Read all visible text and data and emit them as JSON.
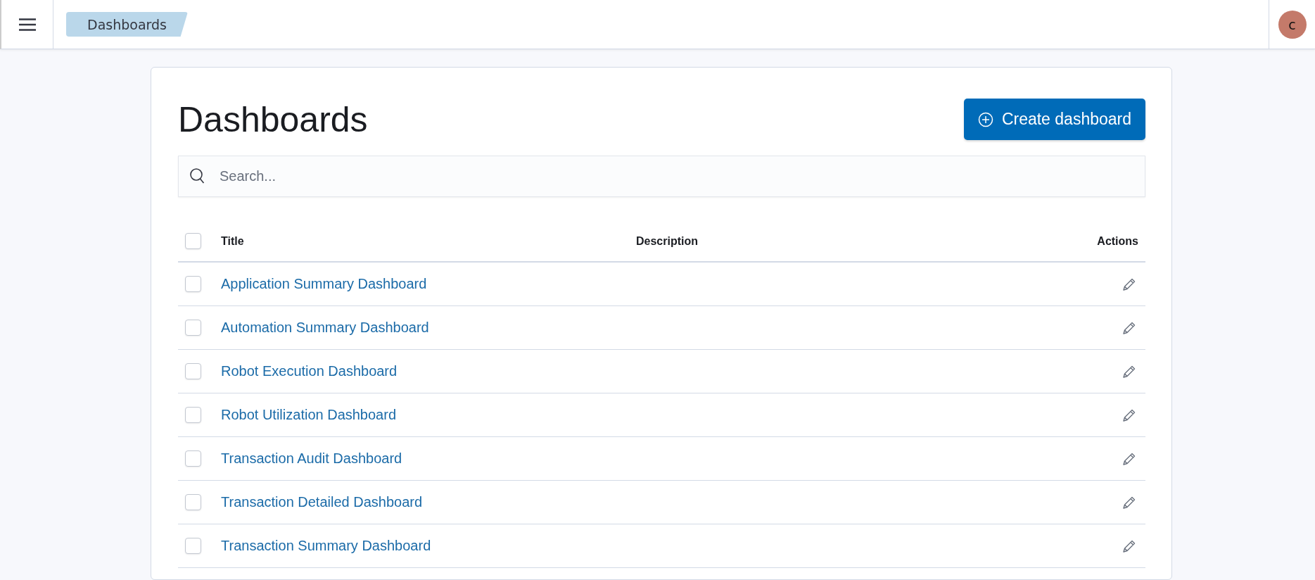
{
  "header": {
    "breadcrumb": "Dashboards",
    "avatar": "c"
  },
  "page": {
    "title": "Dashboards",
    "create_button": "Create dashboard"
  },
  "search": {
    "placeholder": "Search..."
  },
  "table": {
    "select_all_checked": false,
    "columns": [
      "Title",
      "Description",
      "Actions"
    ],
    "rows": [
      {
        "title": "Application Summary Dashboard",
        "checked": false
      },
      {
        "title": "Automation Summary Dashboard",
        "checked": false
      },
      {
        "title": "Robot Execution Dashboard",
        "checked": false
      },
      {
        "title": "Robot Utilization Dashboard",
        "checked": false
      },
      {
        "title": "Transaction Audit Dashboard",
        "checked": false
      },
      {
        "title": "Transaction Detailed Dashboard",
        "checked": false
      },
      {
        "title": "Transaction Summary Dashboard",
        "checked": false
      }
    ]
  }
}
